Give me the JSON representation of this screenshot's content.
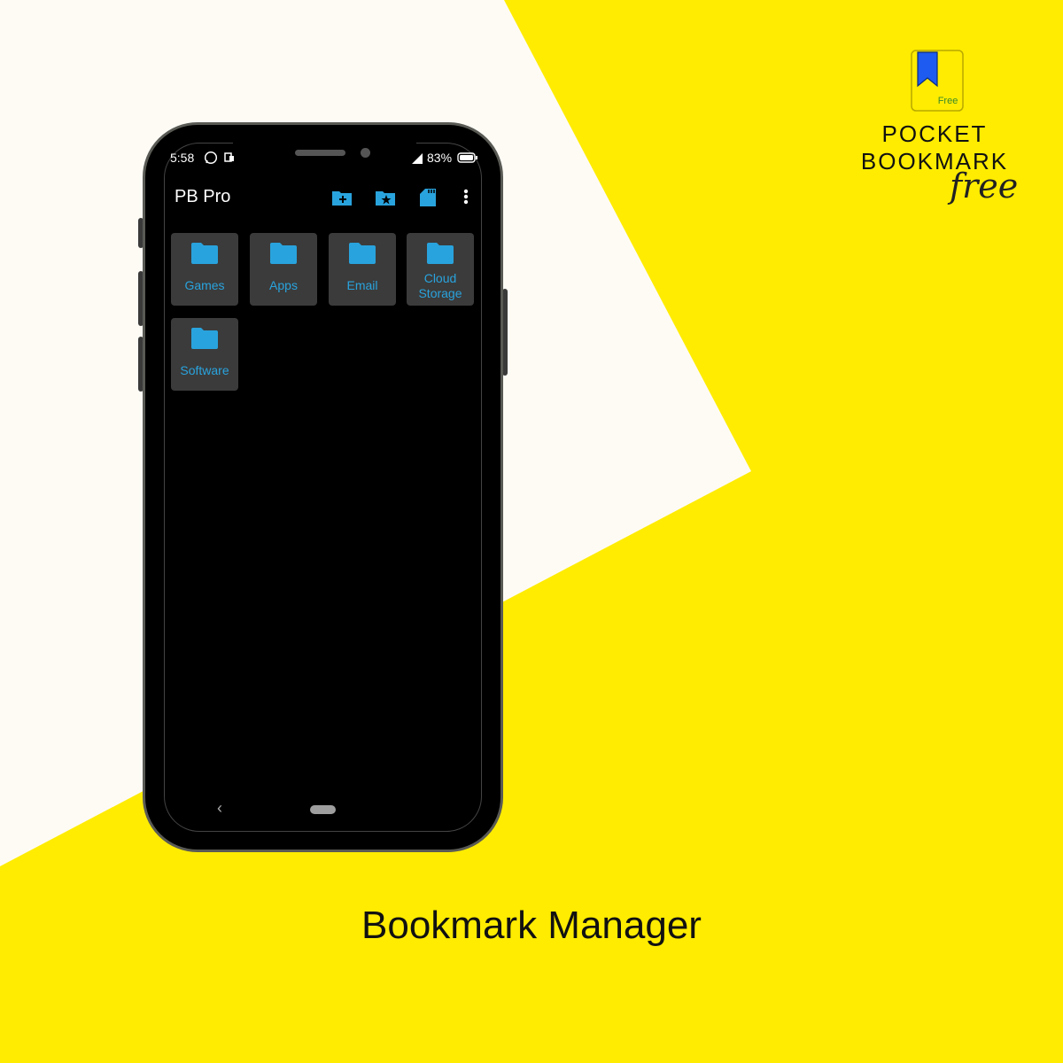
{
  "status_bar": {
    "time": "5:58",
    "battery": "83%"
  },
  "app_bar": {
    "title": "PB Pro",
    "actions": [
      "add-folder",
      "favorite-folder",
      "sd-card",
      "more"
    ]
  },
  "folders": [
    {
      "label": "Games"
    },
    {
      "label": "Apps"
    },
    {
      "label": "Email"
    },
    {
      "label": "Cloud Storage",
      "lines": [
        "Cloud",
        "Storage"
      ]
    },
    {
      "label": "Software"
    }
  ],
  "brand": {
    "line1": "POCKET",
    "line2": "BOOKMARK",
    "script": "free",
    "badge": "Free"
  },
  "caption": "Bookmark Manager",
  "colors": {
    "accent": "#29A3DD",
    "background": "#FFEC00",
    "panel": "#FEFBF5",
    "tile": "#3B3B3B",
    "logo": "#1E5BF0"
  }
}
